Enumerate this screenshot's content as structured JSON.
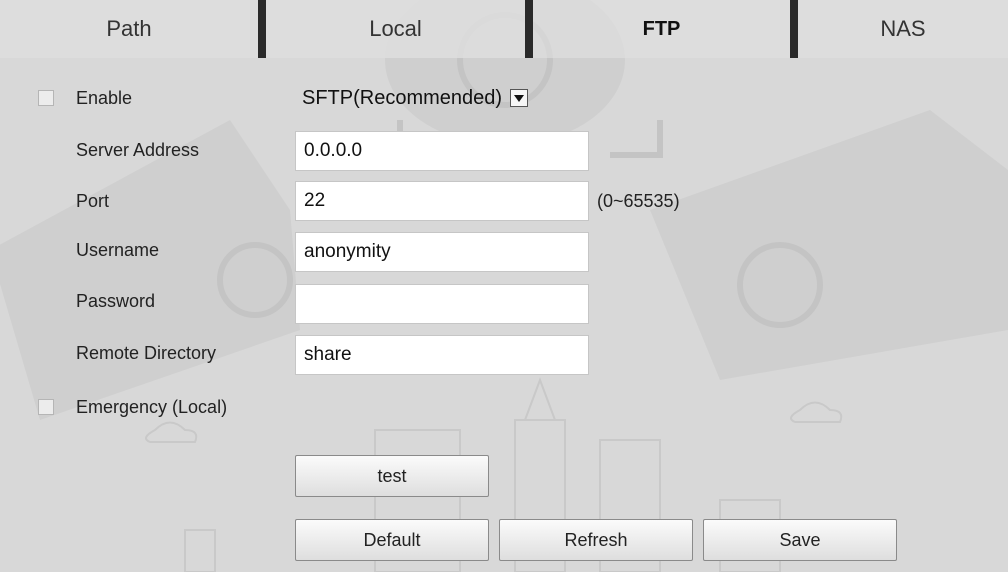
{
  "tabs": [
    {
      "label": "Path",
      "active": false
    },
    {
      "label": "Local",
      "active": false
    },
    {
      "label": "FTP",
      "active": true
    },
    {
      "label": "NAS",
      "active": false
    }
  ],
  "form": {
    "enable": {
      "label": "Enable",
      "checked": false
    },
    "protocol": {
      "value": "SFTP(Recommended)"
    },
    "server_address": {
      "label": "Server Address",
      "value": "0.0.0.0"
    },
    "port": {
      "label": "Port",
      "value": "22",
      "range_hint": "(0~65535)"
    },
    "username": {
      "label": "Username",
      "value": "anonymity"
    },
    "password": {
      "label": "Password",
      "value": ""
    },
    "remote_directory": {
      "label": "Remote Directory",
      "value": "share"
    },
    "emergency": {
      "label": "Emergency (Local)",
      "checked": false
    }
  },
  "buttons": {
    "test": "test",
    "default": "Default",
    "refresh": "Refresh",
    "save": "Save"
  },
  "icons": {
    "dropdown": "chevron-down-icon"
  },
  "colors": {
    "background": "#d8d8d8",
    "tab_separator": "#2a2a2a",
    "input_bg": "#ffffff"
  }
}
